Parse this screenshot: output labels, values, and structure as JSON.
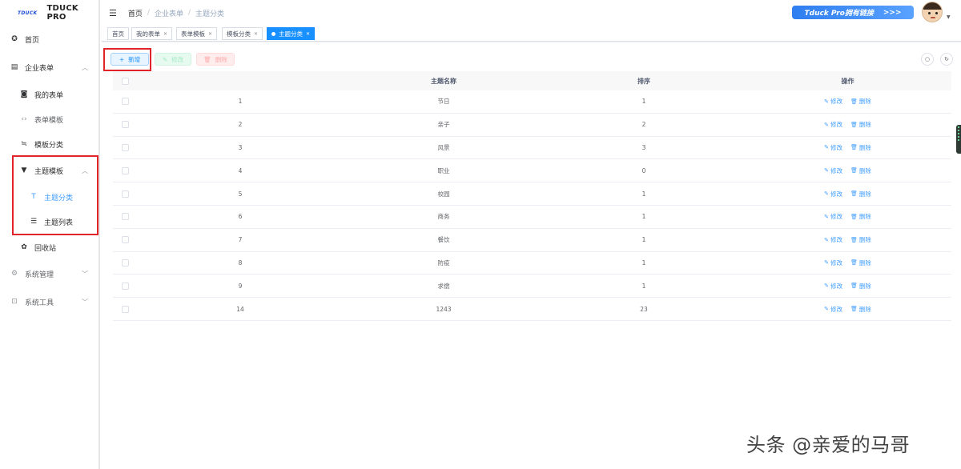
{
  "logo": {
    "mark": "TDUCK",
    "title": "TDUCK PRO"
  },
  "sidebar": {
    "items": [
      {
        "label": "首页",
        "icon": "dashboard-icon"
      },
      {
        "label": "企业表单",
        "icon": "form-icon",
        "expanded": true
      },
      {
        "label": "我的表单",
        "icon": "my-form-icon"
      },
      {
        "label": "表单模板",
        "icon": "code-icon"
      },
      {
        "label": "模板分类",
        "icon": "category-icon"
      },
      {
        "label": "主题模板",
        "icon": "shirt-icon",
        "expanded": true
      },
      {
        "label": "主题分类",
        "icon": "text-icon",
        "active": true
      },
      {
        "label": "主题列表",
        "icon": "list-icon"
      },
      {
        "label": "回收站",
        "icon": "recycle-icon"
      },
      {
        "label": "系统管理",
        "icon": "gear-icon",
        "expanded": false
      },
      {
        "label": "系统工具",
        "icon": "toolbox-icon",
        "expanded": false
      }
    ]
  },
  "header": {
    "breadcrumb": [
      "首页",
      "企业表单",
      "主题分类"
    ],
    "promo": {
      "text": "Tduck Pro拥有链接",
      "arrow": ">>>"
    }
  },
  "tags": [
    {
      "label": "首页"
    },
    {
      "label": "我的表单"
    },
    {
      "label": "表单模板"
    },
    {
      "label": "模板分类"
    },
    {
      "label": "主题分类",
      "active": true
    }
  ],
  "toolbar": {
    "add": "新增",
    "edit": "修改",
    "delete": "删除"
  },
  "table": {
    "headers": {
      "id": "",
      "name": "主题名称",
      "sort": "排序",
      "actions": "操作"
    },
    "edit_label": "修改",
    "delete_label": "删除",
    "rows": [
      {
        "id": "1",
        "name": "节日",
        "sort": "1"
      },
      {
        "id": "2",
        "name": "亲子",
        "sort": "2"
      },
      {
        "id": "3",
        "name": "风景",
        "sort": "3"
      },
      {
        "id": "4",
        "name": "职业",
        "sort": "0"
      },
      {
        "id": "5",
        "name": "校园",
        "sort": "1"
      },
      {
        "id": "6",
        "name": "商务",
        "sort": "1"
      },
      {
        "id": "7",
        "name": "餐饮",
        "sort": "1"
      },
      {
        "id": "8",
        "name": "防疫",
        "sort": "1"
      },
      {
        "id": "9",
        "name": "求偿",
        "sort": "1"
      },
      {
        "id": "14",
        "name": "1243",
        "sort": "23"
      }
    ]
  },
  "watermark": "头条 @亲爱的马哥",
  "colors": {
    "primary": "#409eff",
    "highlight_box": "#e0242a",
    "tag_active": "#1890ff"
  }
}
